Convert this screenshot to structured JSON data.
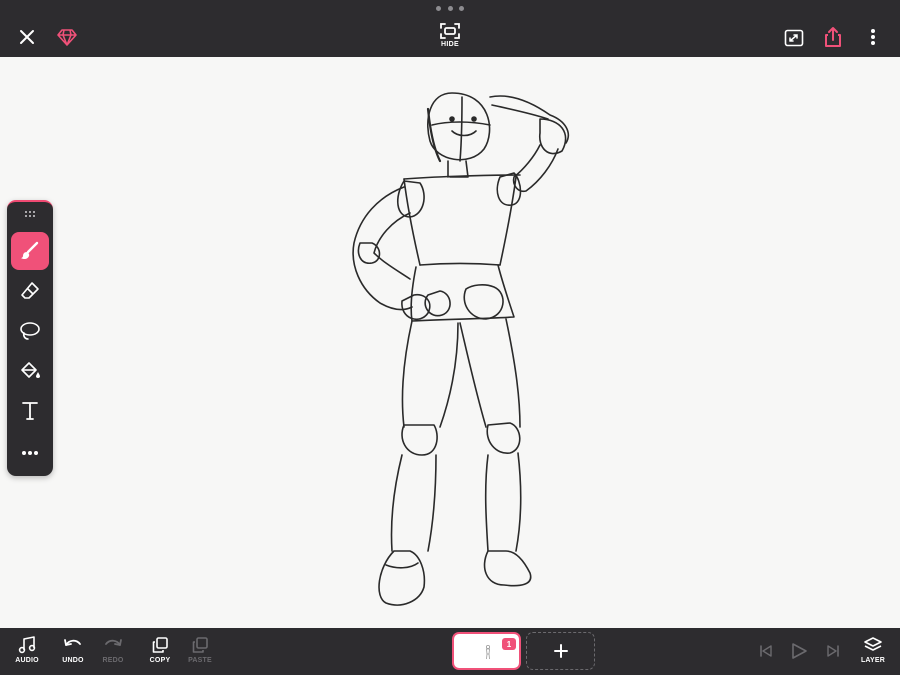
{
  "topbar": {
    "hide_label": "HIDE"
  },
  "palette": {
    "tools": [
      "brush",
      "eraser",
      "lasso",
      "fill",
      "text",
      "more"
    ],
    "active_tool": "brush"
  },
  "bottombar": {
    "audio_label": "AUDIO",
    "undo_label": "UNDO",
    "redo_label": "REDO",
    "copy_label": "COPY",
    "paste_label": "PASTE",
    "layer_label": "LAYER",
    "frame_badge": "1"
  },
  "colors": {
    "accent": "#f05179",
    "chrome": "#2d2c2f",
    "canvas": "#f7f7f6",
    "disabled": "#6b6a6e"
  }
}
